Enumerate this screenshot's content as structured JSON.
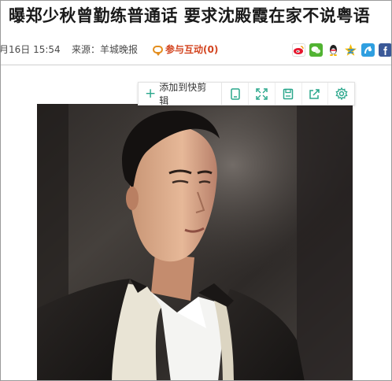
{
  "headline": "曝郑少秋曾勤练普通话 要求沈殿霞在家不说粤语",
  "meta": {
    "date": "月16日 15:54",
    "source": "来源：羊城晚报",
    "interact_label": "参与互动",
    "interact_count": "(0)"
  },
  "share_icons": [
    "weibo-icon",
    "wechat-icon",
    "qq-icon",
    "qzone-icon",
    "tencent-weibo-icon",
    "facebook-icon"
  ],
  "toolbar": {
    "add_label": "添加到快剪辑",
    "icons": [
      "clip-icon",
      "fullscreen-icon",
      "save-icon",
      "share-out-icon",
      "settings-icon"
    ]
  },
  "colors": {
    "accent": "#2aa78c",
    "interact": "#d3441f"
  }
}
